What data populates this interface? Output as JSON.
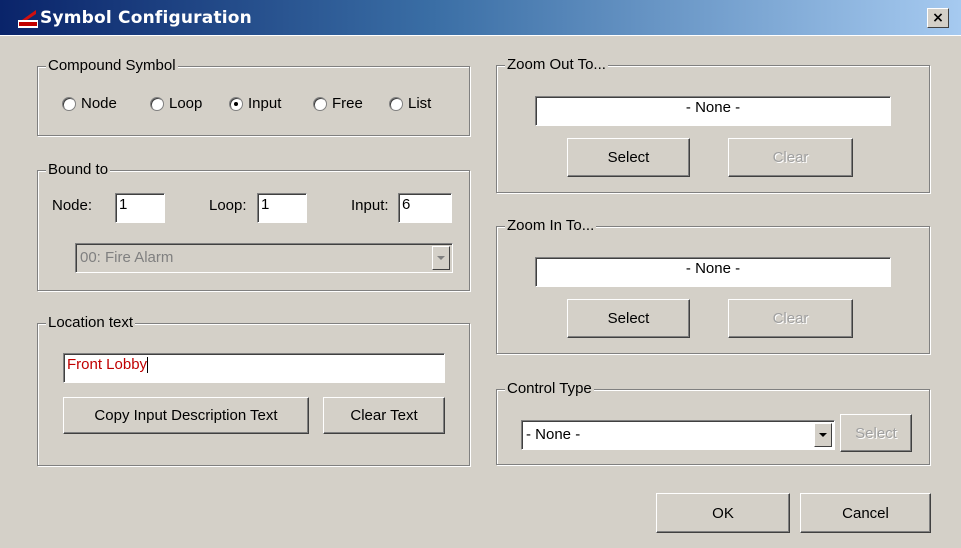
{
  "window": {
    "title": "Symbol Configuration",
    "close_glyph": "×"
  },
  "compound_symbol": {
    "title": "Compound Symbol",
    "options": [
      {
        "label": "Node",
        "checked": false
      },
      {
        "label": "Loop",
        "checked": false
      },
      {
        "label": "Input",
        "checked": true
      },
      {
        "label": "Free",
        "checked": false
      },
      {
        "label": "List",
        "checked": false
      }
    ]
  },
  "bound_to": {
    "title": "Bound to",
    "node_label": "Node:",
    "node_value": "1",
    "loop_label": "Loop:",
    "loop_value": "1",
    "input_label": "Input:",
    "input_value": "6",
    "type_selected": "00: Fire Alarm"
  },
  "location_text": {
    "title": "Location text",
    "value": "Front Lobby",
    "copy_button": "Copy Input Description Text",
    "clear_button": "Clear Text"
  },
  "zoom_out": {
    "title": "Zoom Out To...",
    "value": "- None -",
    "select_button": "Select",
    "clear_button": "Clear"
  },
  "zoom_in": {
    "title": "Zoom In To...",
    "value": "- None -",
    "select_button": "Select",
    "clear_button": "Clear"
  },
  "control_type": {
    "title": "Control Type",
    "selected": "- None -",
    "select_button": "Select"
  },
  "footer": {
    "ok_button": "OK",
    "cancel_button": "Cancel"
  },
  "colors": {
    "title_bar_start": "#0a246a",
    "title_bar_end": "#a6caf0",
    "location_text_color": "#c00000",
    "dialog_bg": "#d4d0c8"
  }
}
